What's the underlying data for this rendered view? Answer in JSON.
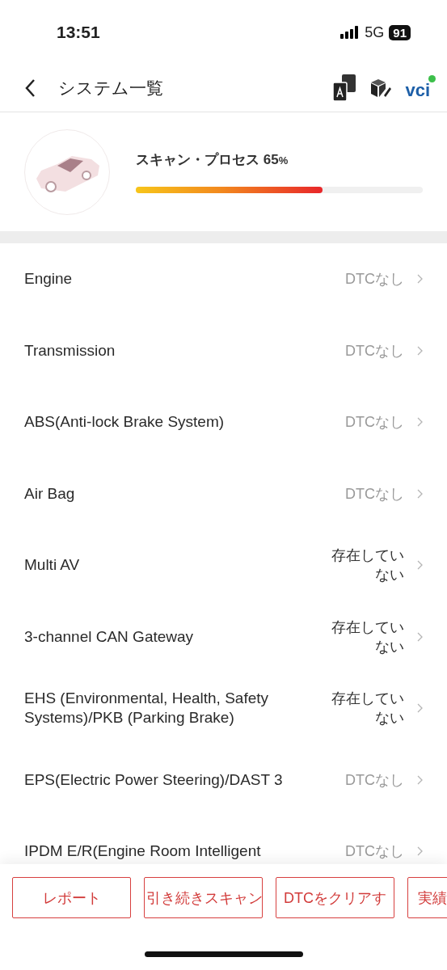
{
  "status_bar": {
    "time": "13:51",
    "network": "5G",
    "battery": "91"
  },
  "nav": {
    "title": "システム一覧",
    "vci": "vci"
  },
  "scan": {
    "label": "スキャン・プロセス",
    "percent": "65",
    "unit": "%",
    "level": 0.65
  },
  "systems": [
    {
      "name": "Engine",
      "status": "DTCなし",
      "kind": "ok"
    },
    {
      "name": "Transmission",
      "status": "DTCなし",
      "kind": "ok"
    },
    {
      "name": "ABS(Anti-lock Brake System)",
      "status": "DTCなし",
      "kind": "ok"
    },
    {
      "name": "Air Bag",
      "status": "DTCなし",
      "kind": "ok"
    },
    {
      "name": "Multi AV",
      "status": "存在していない",
      "kind": "absent"
    },
    {
      "name": "3-channel CAN Gateway",
      "status": "存在していない",
      "kind": "absent"
    },
    {
      "name": "EHS (Environmental, Health, Safety Systems)/PKB (Parking Brake)",
      "status": "存在していない",
      "kind": "absent"
    },
    {
      "name": "EPS(Electric Power Steering)/DAST 3",
      "status": "DTCなし",
      "kind": "ok"
    },
    {
      "name": "IPDM E/R(Engine Room Intelligent",
      "status": "DTCなし",
      "kind": "ok"
    }
  ],
  "buttons": [
    "レポート",
    "引き続きスキャン",
    "DTCをクリアす",
    "実績"
  ]
}
